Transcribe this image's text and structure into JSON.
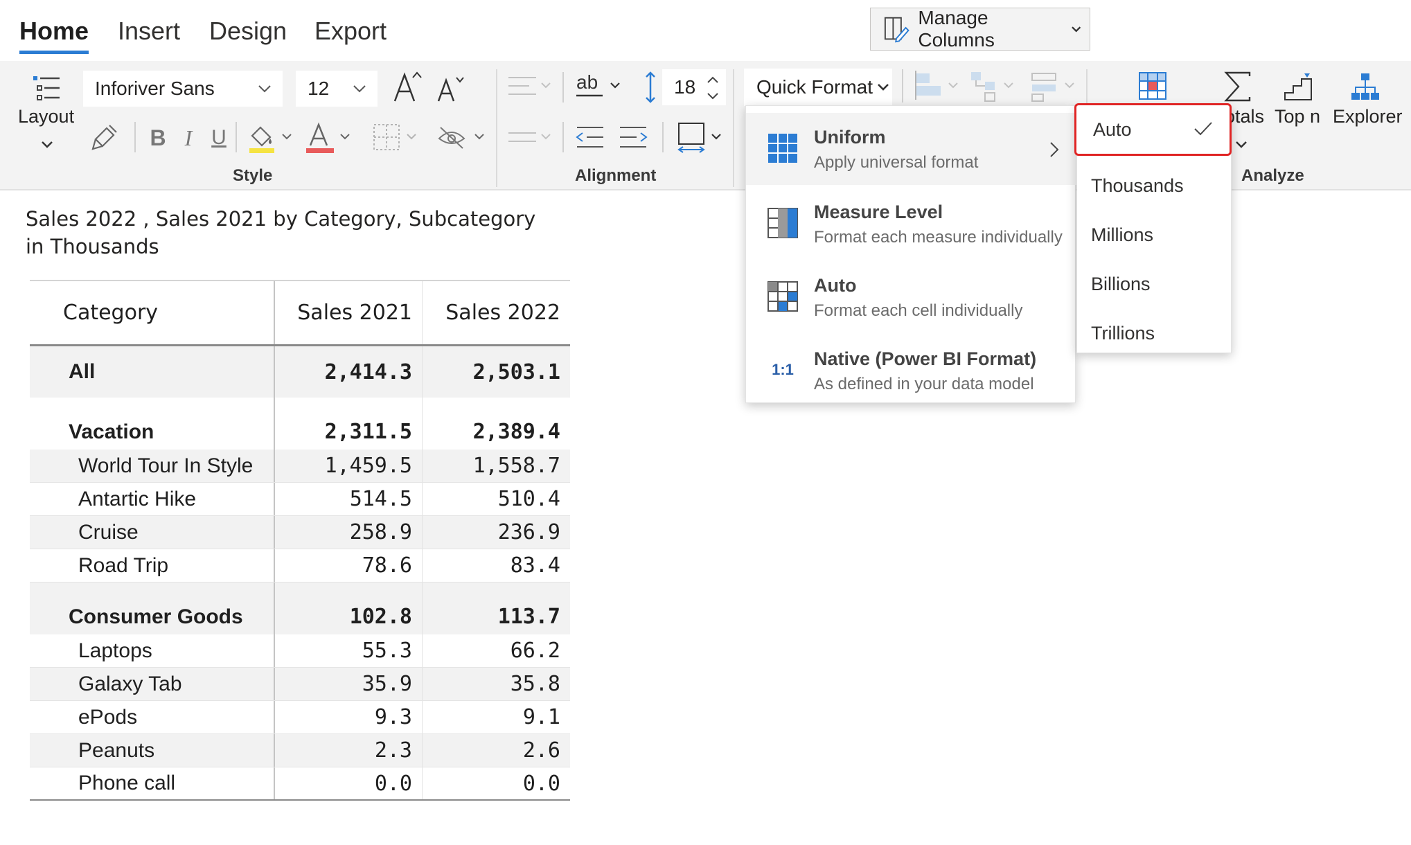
{
  "tabs": [
    {
      "label": "Home",
      "active": true
    },
    {
      "label": "Insert",
      "active": false
    },
    {
      "label": "Design",
      "active": false
    },
    {
      "label": "Export",
      "active": false
    }
  ],
  "manage_columns": {
    "label": "Manage Columns"
  },
  "ribbon": {
    "layout_label": "Layout",
    "font_name": "Inforiver Sans",
    "font_size": "12",
    "line_height": "18",
    "quick_format_label": "Quick Format",
    "totals_label": "otals",
    "topn_label": "Top n",
    "explorer_label": "Explorer",
    "groups": {
      "style": "Style",
      "alignment": "Alignment",
      "analyze": "Analyze"
    },
    "colors": {
      "highlight": "#f5e342",
      "font_color": "#e85a5a",
      "accent": "#2b7cd3"
    }
  },
  "report": {
    "title_line1": "Sales 2022 , Sales 2021 by Category, Subcategory",
    "title_line2": "in Thousands"
  },
  "table": {
    "headers": [
      "Category",
      "Sales 2021",
      "Sales 2022"
    ],
    "all": {
      "label": "All",
      "v2021": "2,414.3",
      "v2022": "2,503.1"
    },
    "groups": [
      {
        "label": "Vacation",
        "v2021": "2,311.5",
        "v2022": "2,389.4",
        "rows": [
          {
            "label": "World Tour In Style",
            "v2021": "1,459.5",
            "v2022": "1,558.7"
          },
          {
            "label": "Antartic Hike",
            "v2021": "514.5",
            "v2022": "510.4"
          },
          {
            "label": "Cruise",
            "v2021": "258.9",
            "v2022": "236.9"
          },
          {
            "label": "Road Trip",
            "v2021": "78.6",
            "v2022": "83.4"
          }
        ]
      },
      {
        "label": "Consumer Goods",
        "v2021": "102.8",
        "v2022": "113.7",
        "rows": [
          {
            "label": "Laptops",
            "v2021": "55.3",
            "v2022": "66.2"
          },
          {
            "label": "Galaxy Tab",
            "v2021": "35.9",
            "v2022": "35.8"
          },
          {
            "label": "ePods",
            "v2021": "9.3",
            "v2022": "9.1"
          },
          {
            "label": "Peanuts",
            "v2021": "2.3",
            "v2022": "2.6"
          },
          {
            "label": "Phone call",
            "v2021": "0.0",
            "v2022": "0.0"
          }
        ]
      }
    ]
  },
  "quick_format_menu": [
    {
      "title": "Uniform",
      "subtitle": "Apply universal format",
      "icon": "uniform-grid-icon",
      "has_submenu": true
    },
    {
      "title": "Measure Level",
      "subtitle": "Format each measure individually",
      "icon": "measure-level-icon"
    },
    {
      "title": "Auto",
      "subtitle": "Format each cell individually",
      "icon": "auto-format-icon"
    },
    {
      "title": "Native (Power BI Format)",
      "subtitle": "As defined in your data model",
      "icon": "native-1to1-icon",
      "icon_text": "1:1"
    }
  ],
  "unit_menu": [
    {
      "label": "Auto",
      "selected": true
    },
    {
      "label": "Thousands"
    },
    {
      "label": "Millions"
    },
    {
      "label": "Billions"
    },
    {
      "label": "Trillions"
    }
  ]
}
